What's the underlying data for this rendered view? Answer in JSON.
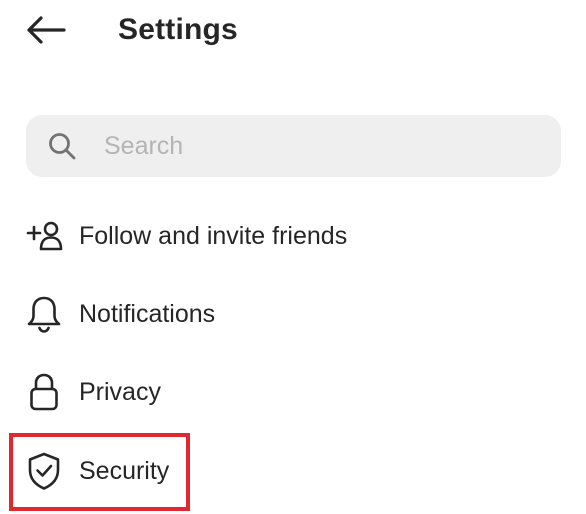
{
  "header": {
    "title": "Settings",
    "back_icon": "arrow-left-icon"
  },
  "search": {
    "placeholder": "Search",
    "value": "",
    "icon": "search-icon"
  },
  "menu": {
    "items": [
      {
        "label": "Follow and invite friends",
        "icon": "add-person-icon"
      },
      {
        "label": "Notifications",
        "icon": "bell-icon"
      },
      {
        "label": "Privacy",
        "icon": "lock-icon"
      },
      {
        "label": "Security",
        "icon": "shield-check-icon"
      }
    ]
  },
  "annotation": {
    "highlighted_item": "Security",
    "highlight_color": "#e0282e"
  },
  "colors": {
    "text": "#262626",
    "search_background": "#efefef",
    "placeholder": "#b4b4b4"
  }
}
